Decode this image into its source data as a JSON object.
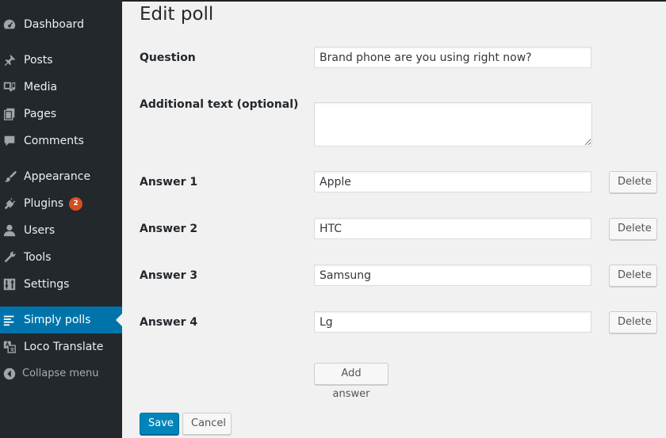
{
  "sidebar": {
    "items": [
      {
        "label": "Dashboard",
        "icon": "dashboard-icon"
      },
      {
        "label": "Posts",
        "icon": "pushpin-icon"
      },
      {
        "label": "Media",
        "icon": "media-icon"
      },
      {
        "label": "Pages",
        "icon": "pages-icon"
      },
      {
        "label": "Comments",
        "icon": "comment-icon"
      },
      {
        "label": "Appearance",
        "icon": "paintbrush-icon"
      },
      {
        "label": "Plugins",
        "icon": "plugin-icon",
        "badge": "2"
      },
      {
        "label": "Users",
        "icon": "user-icon"
      },
      {
        "label": "Tools",
        "icon": "wrench-icon"
      },
      {
        "label": "Settings",
        "icon": "sliders-icon"
      },
      {
        "label": "Simply polls",
        "icon": "list-icon",
        "active": true
      },
      {
        "label": "Loco Translate",
        "icon": "translate-icon"
      }
    ],
    "collapse_label": "Collapse menu"
  },
  "page": {
    "title": "Edit poll"
  },
  "form": {
    "question_label": "Question",
    "question_value": "Brand phone are you using right now?",
    "additional_label": "Additional text (optional)",
    "additional_value": "",
    "answers": [
      {
        "label": "Answer 1",
        "value": "Apple"
      },
      {
        "label": "Answer 2",
        "value": "HTC"
      },
      {
        "label": "Answer 3",
        "value": "Samsung"
      },
      {
        "label": "Answer 4",
        "value": "Lg"
      }
    ],
    "delete_label": "Delete",
    "add_answer_label": "Add answer",
    "save_label": "Save",
    "cancel_label": "Cancel"
  },
  "colors": {
    "sidebar_bg": "#23282d",
    "active_bg": "#0073aa",
    "primary_button": "#0085ba",
    "badge": "#d54e21",
    "page_bg": "#f1f1f1"
  }
}
